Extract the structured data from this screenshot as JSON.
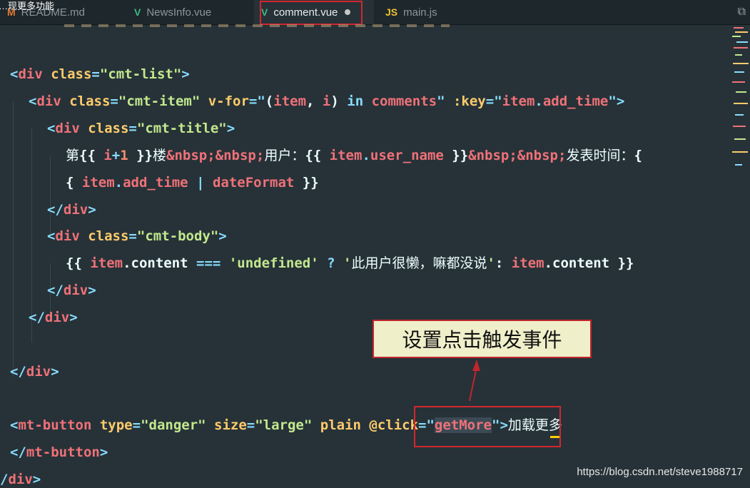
{
  "top_clip": "…现更多功能",
  "tabs": [
    {
      "icon": "M",
      "label": "README.md"
    },
    {
      "icon": "V",
      "label": "NewsInfo.vue"
    },
    {
      "icon": "V",
      "label": "comment.vue"
    },
    {
      "icon": "JS",
      "label": "main.js"
    }
  ],
  "code": {
    "l1": {
      "a": "<",
      "b": "div",
      "c": " class",
      "d": "=",
      "e": "\"cmt-list\"",
      "f": ">"
    },
    "l2": {
      "a": "<",
      "b": "div",
      "c": " class",
      "d": "=",
      "e": "\"cmt-item\"",
      "g": " v-for",
      "h": "=\"",
      "i": "(",
      "j": "item",
      "k": ", ",
      "m": "i",
      "n": ")",
      "o": " in ",
      "p": "comments",
      "q": "\"",
      "r": " :key",
      "s": "=\"",
      "t": "item",
      "u": ".",
      "v": "add_time",
      "w": "\"",
      "x": ">"
    },
    "l3": {
      "a": "<",
      "b": "div",
      "c": " class",
      "d": "=",
      "e": "\"cmt-title\"",
      "f": ">"
    },
    "l4": {
      "a": "第",
      "b": "{{ ",
      "c": "i",
      "d": "+",
      "e": "1",
      "f": " }}",
      "g": "楼",
      "h": "&nbsp;&nbsp;",
      "i": "用户：",
      "j": "{{ ",
      "k": "item",
      "l": ".",
      "m": "user_name",
      "n": " }}",
      "o": "&nbsp;&nbsp;",
      "p": "发表时间：",
      "q": "{"
    },
    "l5": {
      "a": "{ ",
      "b": "item",
      "c": ".",
      "d": "add_time",
      "e": " | ",
      "f": "dateFormat",
      "g": " }}"
    },
    "l6": {
      "a": "</",
      "b": "div",
      "c": ">"
    },
    "l7": {
      "a": "<",
      "b": "div",
      "c": " class",
      "d": "=",
      "e": "\"cmt-body\"",
      "f": ">"
    },
    "l8": {
      "a": "{{ ",
      "b": "item",
      "c": ".content",
      "d": " === ",
      "e": "'undefined'",
      "f": " ? ",
      "g": "'",
      "h": "此用户很懒，嘛都没说",
      "i": "'",
      "j": ": ",
      "k": "item",
      "l": ".content",
      "m": " }}"
    },
    "l9": {
      "a": "</",
      "b": "div",
      "c": ">"
    },
    "l10": {
      "a": "</",
      "b": "div",
      "c": ">"
    },
    "l11": {
      "a": "</",
      "b": "div",
      "c": ">"
    },
    "l12": {
      "a": "<",
      "b": "mt-button",
      "c": " type",
      "d": "=",
      "e": "\"danger\"",
      "f": " size",
      "g": "=",
      "h": "\"large\"",
      "i": " plain",
      "j": " @click",
      "k": "=\"",
      "l": "getMore",
      "m": "\"",
      "n": ">",
      "o": "加载更多"
    },
    "l13": {
      "a": "</",
      "b": "mt-button",
      "c": ">"
    },
    "l14": {
      "a": "/",
      "b": "div",
      "c": ">"
    }
  },
  "annotation": "设置点击触发事件",
  "watermark": "https://blog.csdn.net/steve1988717",
  "colors": {
    "background": "#263238",
    "tag": "#f07178",
    "attr": "#ffcb6b",
    "string": "#c3e88d",
    "punctuation": "#89ddff",
    "annotation_border": "#c0262c",
    "annotation_fill": "#efefca"
  }
}
